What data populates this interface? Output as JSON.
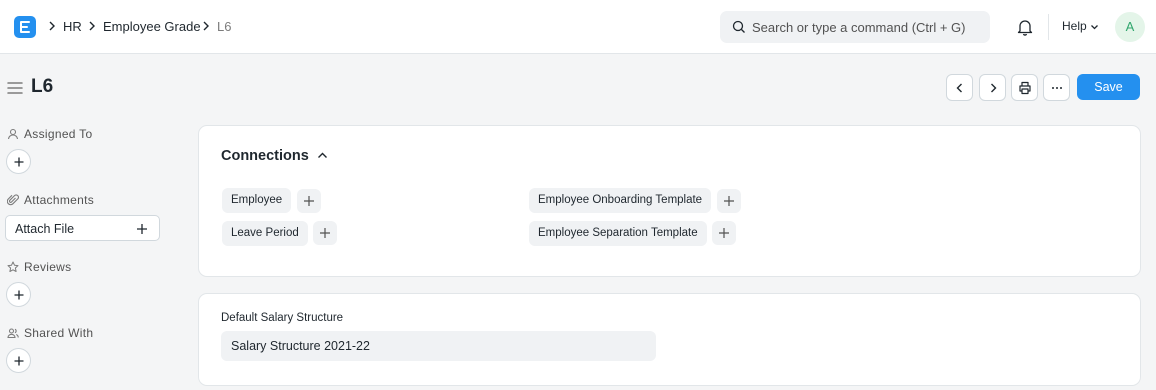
{
  "breadcrumb": {
    "items": [
      "HR",
      "Employee Grade",
      "L6"
    ]
  },
  "search": {
    "placeholder": "Search or type a command (Ctrl + G)"
  },
  "navbar": {
    "help_label": "Help",
    "avatar_initial": "A"
  },
  "page": {
    "title": "L6"
  },
  "toolbar": {
    "save_label": "Save",
    "more_label": "···"
  },
  "sidebar": {
    "assigned_to_label": "Assigned To",
    "attachments_label": "Attachments",
    "attach_file_label": "Attach File",
    "reviews_label": "Reviews",
    "shared_with_label": "Shared With"
  },
  "connections": {
    "title": "Connections",
    "items": [
      "Employee",
      "Leave Period",
      "Employee Onboarding Template",
      "Employee Separation Template"
    ]
  },
  "form": {
    "default_salary_structure_label": "Default Salary Structure",
    "default_salary_structure_value": "Salary Structure 2021-22"
  },
  "colors": {
    "primary": "#2490ef",
    "avatar_bg": "#e4f5e9",
    "avatar_text": "#30a66d"
  }
}
